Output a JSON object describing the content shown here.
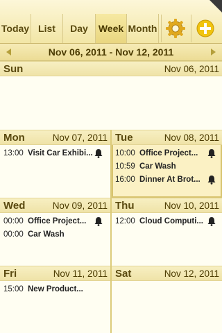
{
  "header": {
    "tabs": [
      {
        "label": "Today"
      },
      {
        "label": "List"
      },
      {
        "label": "Day"
      },
      {
        "label": "Week",
        "active": true
      },
      {
        "label": "Month"
      }
    ],
    "settings_icon": "gear-icon",
    "add_icon": "plus-circle-icon"
  },
  "navbar": {
    "range": "Nov 06, 2011 - Nov 12, 2011"
  },
  "days": {
    "sun": {
      "name": "Sun",
      "date": "Nov 06, 2011",
      "events": []
    },
    "mon": {
      "name": "Mon",
      "date": "Nov 07, 2011",
      "events": [
        {
          "time": "13:00",
          "title": "Visit Car Exhibi...",
          "alarm": true
        }
      ]
    },
    "tue": {
      "name": "Tue",
      "date": "Nov 08, 2011",
      "events": [
        {
          "time": "10:00",
          "title": "Office Project...",
          "alarm": true
        },
        {
          "time": "10:59",
          "title": "Car Wash",
          "alarm": false
        },
        {
          "time": "16:00",
          "title": "Dinner At Brot...",
          "alarm": true
        }
      ]
    },
    "wed": {
      "name": "Wed",
      "date": "Nov 09, 2011",
      "events": [
        {
          "time": "00:00",
          "title": "Office Project...",
          "alarm": true
        },
        {
          "time": "00:00",
          "title": "Car Wash",
          "alarm": false
        }
      ]
    },
    "thu": {
      "name": "Thu",
      "date": "Nov 10, 2011",
      "events": [
        {
          "time": "12:00",
          "title": "Cloud Computi...",
          "alarm": true
        }
      ]
    },
    "fri": {
      "name": "Fri",
      "date": "Nov 11, 2011",
      "events": [
        {
          "time": "15:00",
          "title": "New Product...",
          "alarm": false
        }
      ]
    },
    "sat": {
      "name": "Sat",
      "date": "Nov 12, 2011",
      "events": []
    }
  },
  "colors": {
    "accent": "#f2e6a6",
    "today_highlight": "#fbf1c4",
    "text": "#4a3a00"
  }
}
